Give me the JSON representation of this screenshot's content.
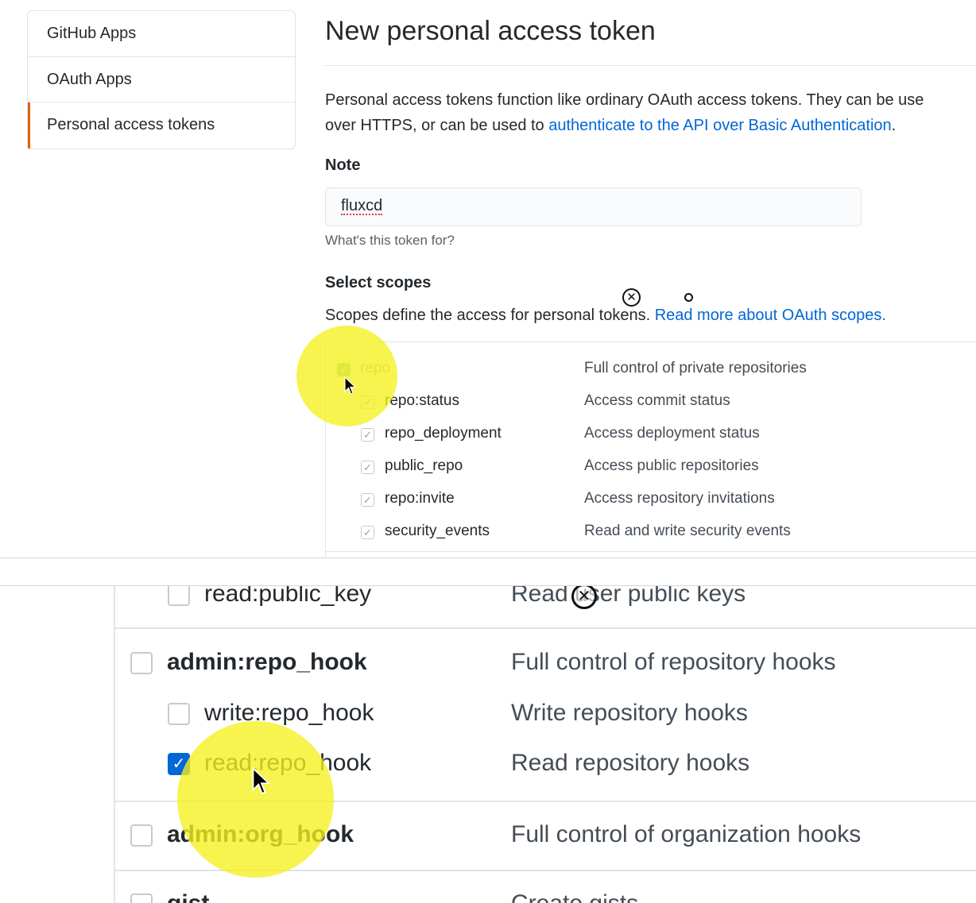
{
  "sidebar": {
    "items": [
      {
        "label": "GitHub Apps"
      },
      {
        "label": "OAuth Apps"
      },
      {
        "label": "Personal access tokens"
      }
    ]
  },
  "page": {
    "title": "New personal access token",
    "intro_line1": "Personal access tokens function like ordinary OAuth access tokens. They can be use",
    "intro_line2_prefix": "over HTTPS, or can be used to ",
    "intro_link": "authenticate to the API over Basic Authentication",
    "intro_line2_suffix": "."
  },
  "note": {
    "label": "Note",
    "value": "fluxcd",
    "help": "What's this token for?"
  },
  "scopes": {
    "label": "Select scopes",
    "desc_prefix": "Scopes define the access for personal tokens. ",
    "desc_link": "Read more about OAuth scopes.",
    "top_rows": [
      {
        "name": "repo",
        "desc": "Full control of private repositories",
        "checked": true,
        "parent": true
      },
      {
        "name": "repo:status",
        "desc": "Access commit status",
        "checked": true,
        "parent": false
      },
      {
        "name": "repo_deployment",
        "desc": "Access deployment status",
        "checked": true,
        "parent": false
      },
      {
        "name": "public_repo",
        "desc": "Access public repositories",
        "checked": true,
        "parent": false
      },
      {
        "name": "repo:invite",
        "desc": "Access repository invitations",
        "checked": true,
        "parent": false
      },
      {
        "name": "security_events",
        "desc": "Read and write security events",
        "checked": true,
        "parent": false
      }
    ],
    "bottom_rows": [
      {
        "name": "read:public_key",
        "desc": "Read user public keys",
        "checked": false,
        "parent": false
      },
      {
        "name": "admin:repo_hook",
        "desc": "Full control of repository hooks",
        "checked": false,
        "parent": true
      },
      {
        "name": "write:repo_hook",
        "desc": "Write repository hooks",
        "checked": false,
        "parent": false
      },
      {
        "name": "read:repo_hook",
        "desc": "Read repository hooks",
        "checked": true,
        "parent": false
      },
      {
        "name": "admin:org_hook",
        "desc": "Full control of organization hooks",
        "checked": false,
        "parent": true
      },
      {
        "name": "gist",
        "desc": "Create gists",
        "checked": false,
        "parent": true
      }
    ]
  },
  "icons": {
    "check": "check-icon",
    "pointer": "mouse-pointer-icon",
    "loading": "loading-x-icon"
  },
  "colors": {
    "link": "#0366d6",
    "selected_border": "#e36209",
    "highlight": "#f5f01e",
    "checked_bg": "#0366d6"
  }
}
